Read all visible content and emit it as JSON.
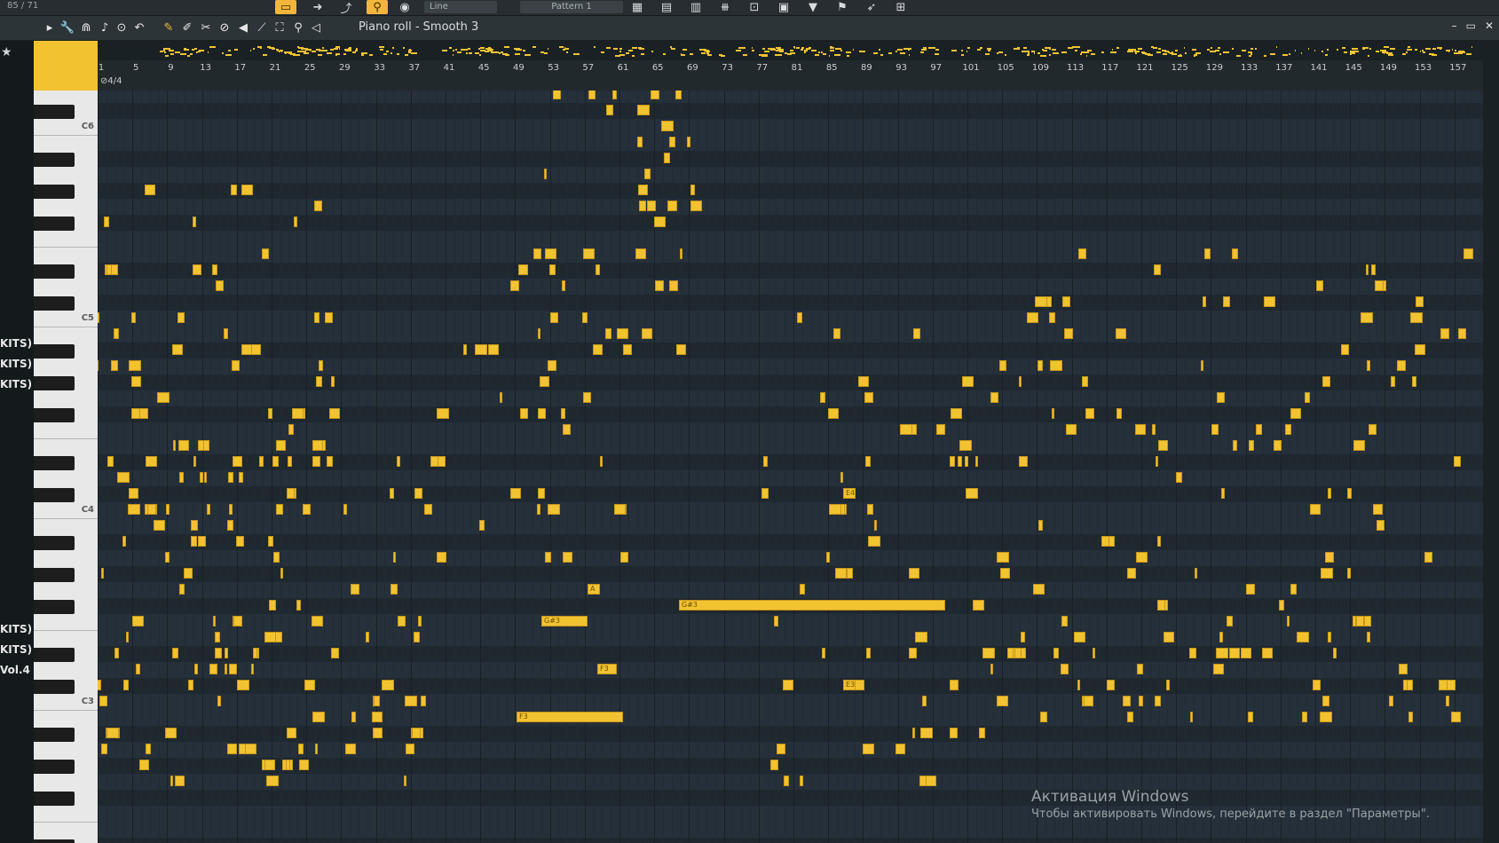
{
  "topbar": {
    "counter": "85 / 71",
    "snap_label": "Line",
    "pattern_label": "Pattern 1",
    "buttons": [
      {
        "name": "record-mode-button",
        "glyph": "▭",
        "active": true
      },
      {
        "name": "step-forward-button",
        "glyph": "➜",
        "active": false
      },
      {
        "name": "curve-tool-button",
        "glyph": "⤴",
        "active": false
      },
      {
        "name": "link-button",
        "glyph": "⚲",
        "active": true
      },
      {
        "name": "metronome-button",
        "glyph": "◉",
        "active": false
      }
    ],
    "right_buttons": [
      "▦",
      "▤",
      "▥",
      "⧻",
      "⊡",
      "▣",
      "▼",
      "⚑",
      "➶",
      "⊞"
    ]
  },
  "toolbar": {
    "title": "Piano roll - Smooth 3",
    "tools": [
      {
        "name": "play-arrow-icon",
        "glyph": "▸",
        "yellow": false
      },
      {
        "name": "wrench-icon",
        "glyph": "🔧",
        "yellow": false
      },
      {
        "name": "magnet-icon",
        "glyph": "⋒",
        "yellow": false
      },
      {
        "name": "note-icon",
        "glyph": "♪",
        "yellow": false
      },
      {
        "name": "circle-icon",
        "glyph": "⊙",
        "yellow": false
      },
      {
        "name": "undo-icon",
        "glyph": "↶",
        "yellow": false
      },
      {
        "name": "pencil-icon",
        "glyph": "✎",
        "yellow": true
      },
      {
        "name": "paint-icon",
        "glyph": "✐",
        "yellow": false
      },
      {
        "name": "delete-icon",
        "glyph": "✂",
        "yellow": false
      },
      {
        "name": "erase-icon",
        "glyph": "⊘",
        "yellow": false
      },
      {
        "name": "mute-icon",
        "glyph": "◀",
        "yellow": false
      },
      {
        "name": "slice-icon",
        "glyph": "⟋",
        "yellow": false
      },
      {
        "name": "select-icon",
        "glyph": "⛶",
        "yellow": false
      },
      {
        "name": "zoom-icon",
        "glyph": "⚲",
        "yellow": false
      },
      {
        "name": "speaker-icon",
        "glyph": "◁",
        "yellow": false
      }
    ]
  },
  "window_controls": [
    "–",
    "▭",
    "✕"
  ],
  "left_labels": [
    "KITS)",
    "KITS)",
    "KITS)",
    "KITS)",
    "KITS)",
    "Vol.4"
  ],
  "ruler": {
    "bars": [
      "1",
      "5",
      "9",
      "13",
      "17",
      "21",
      "25",
      "29",
      "33",
      "37",
      "41",
      "45",
      "49",
      "53",
      "57",
      "61",
      "65",
      "69",
      "73",
      "77",
      "81",
      "85",
      "89",
      "93",
      "97",
      "101",
      "105",
      "109",
      "113",
      "117",
      "121",
      "125",
      "129",
      "133",
      "137",
      "141",
      "145",
      "149",
      "153",
      "157"
    ],
    "time_signature": "4/4"
  },
  "keyboard": {
    "octave_labels": [
      "C6",
      "C5",
      "C4",
      "C3"
    ]
  },
  "notes_labels": [
    "G#3",
    "A",
    "F3",
    "E4",
    "E3",
    "F3"
  ],
  "watermark": {
    "line1": "Активация Windows",
    "line2": "Чтобы активировать Windows, перейдите в раздел \"Параметры\"."
  },
  "colors": {
    "note": "#f2c331",
    "accent": "#f3b53c",
    "background": "#26303a"
  }
}
